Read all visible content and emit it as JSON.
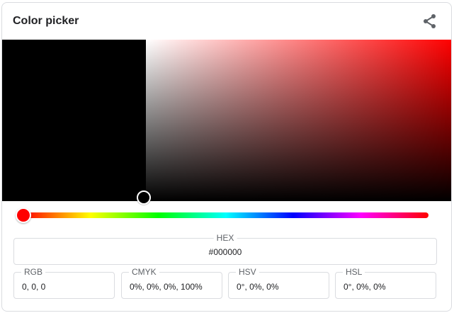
{
  "card": {
    "title": "Color picker"
  },
  "colors": {
    "selected": "#000000",
    "hue": "#ff0000"
  },
  "hex": {
    "label": "HEX",
    "value": "#000000"
  },
  "rgb": {
    "label": "RGB",
    "value": "0, 0, 0"
  },
  "cmyk": {
    "label": "CMYK",
    "value": "0%, 0%, 0%, 100%"
  },
  "hsv": {
    "label": "HSV",
    "value": "0°, 0%, 0%"
  },
  "hsl": {
    "label": "HSL",
    "value": "0°, 0%, 0%"
  },
  "icons": {
    "share": "share-icon"
  }
}
